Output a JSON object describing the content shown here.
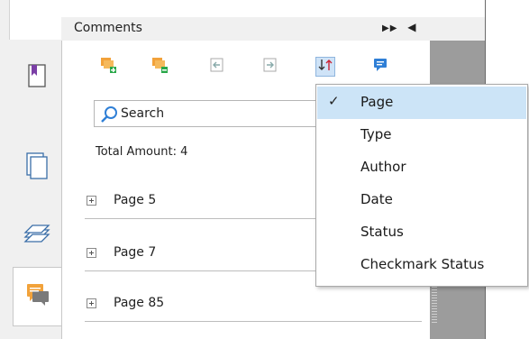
{
  "panel": {
    "title": "Comments",
    "header_controls": {
      "expand": "⏩",
      "collapse": "◀"
    }
  },
  "left_strip": {
    "items": [
      {
        "icon": "bookmark-page-icon",
        "active": false
      },
      {
        "icon": "pages-icon",
        "active": false
      },
      {
        "icon": "layers-icon",
        "active": false
      },
      {
        "icon": "comments-icon",
        "active": true
      }
    ]
  },
  "toolbar": {
    "items": [
      {
        "icon": "expand-all-comments-icon"
      },
      {
        "icon": "collapse-all-comments-icon"
      },
      {
        "icon": "import-comments-icon"
      },
      {
        "icon": "export-comments-icon"
      },
      {
        "icon": "sort-icon",
        "active": true
      },
      {
        "icon": "comment-options-icon"
      }
    ]
  },
  "search": {
    "placeholder": "Search"
  },
  "summary": {
    "total": "Total Amount: 4"
  },
  "groups": [
    {
      "label": "Page 5"
    },
    {
      "label": "Page 7"
    },
    {
      "label": "Page 85"
    }
  ],
  "sort_menu": {
    "items": [
      {
        "label": "Page",
        "checked": true
      },
      {
        "label": "Type",
        "checked": false
      },
      {
        "label": "Author",
        "checked": false
      },
      {
        "label": "Date",
        "checked": false
      },
      {
        "label": "Status",
        "checked": false
      },
      {
        "label": "Checkmark Status",
        "checked": false
      }
    ],
    "check_glyph": "✓"
  },
  "colors": {
    "accent_orange": "#f0a030",
    "accent_blue": "#2f7fd6",
    "menu_highlight": "#cce4f7"
  }
}
